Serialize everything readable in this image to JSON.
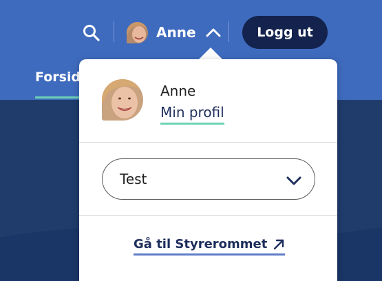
{
  "header": {
    "user_name": "Anne",
    "logout_label": "Logg ut",
    "nav_item": "Forside"
  },
  "dropdown": {
    "profile_name": "Anne",
    "profile_link": "Min profil",
    "select_value": "Test",
    "styrerom_link": "Gå til Styrerommet"
  },
  "icons": {
    "search": "search-icon",
    "chevron_up": "chevron-up-icon",
    "chevron_down": "chevron-down-icon",
    "external": "arrow-up-right-icon"
  },
  "colors": {
    "header_bg": "#3f6bbe",
    "dark_bg": "#1f3c6b",
    "logout_bg": "#13234d",
    "accent_green": "#6dd3b4",
    "accent_blue": "#5f7cc8"
  }
}
